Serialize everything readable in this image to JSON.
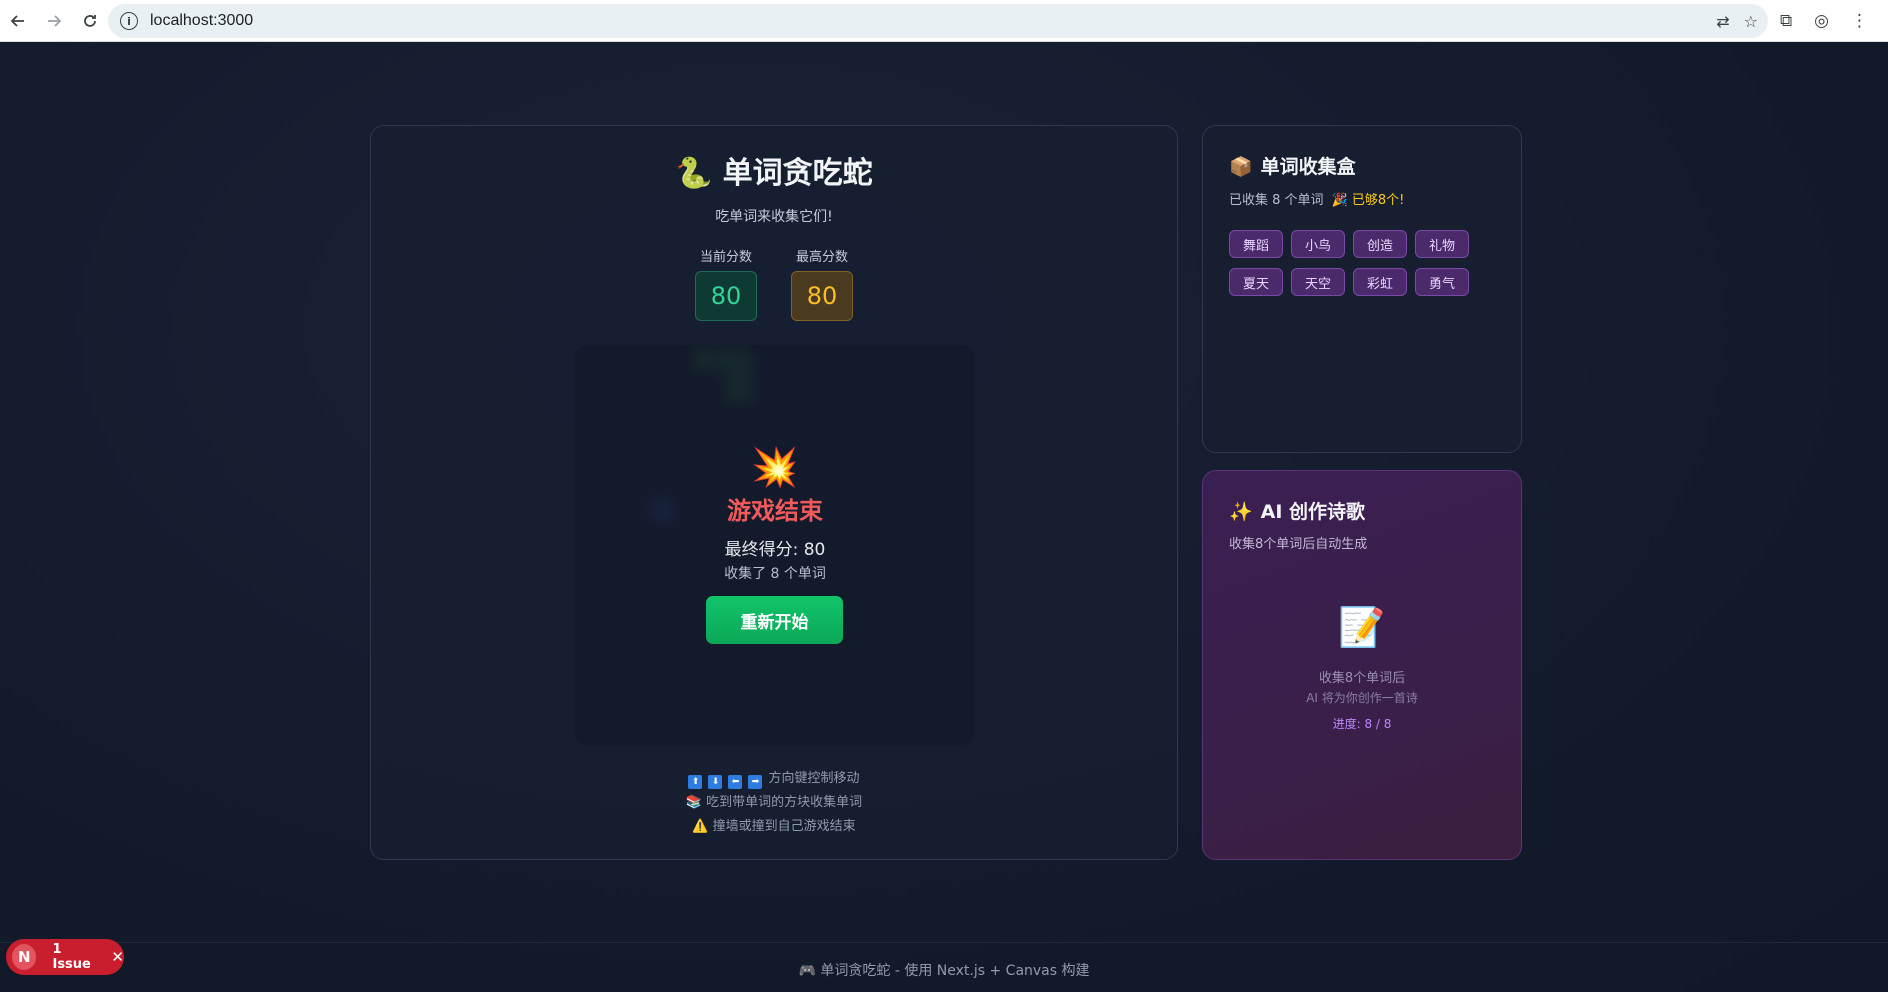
{
  "browser": {
    "url": "localhost:3000",
    "back_icon": "back-arrow-icon",
    "forward_icon": "forward-arrow-icon",
    "reload_icon": "reload-icon"
  },
  "game": {
    "title": "单词贪吃蛇",
    "title_emoji": "🐍",
    "subtitle": "吃单词来收集它们!",
    "current_score_label": "当前分数",
    "current_score": "80",
    "best_score_label": "最高分数",
    "best_score": "80",
    "game_over": {
      "emoji": "💥",
      "title": "游戏结束",
      "final_score": "最终得分: 80",
      "words_collected": "收集了 8 个单词",
      "restart_label": "重新开始"
    },
    "help": {
      "keys": [
        "⬆",
        "⬇",
        "⬅",
        "➡"
      ],
      "move": "方向键控制移动",
      "eat_emoji": "📚",
      "eat": "吃到带单词的方块收集单词",
      "warn_emoji": "⚠️",
      "warn": "撞墙或撞到自己游戏结束"
    }
  },
  "collection": {
    "emoji": "📦",
    "title": "单词收集盒",
    "status": "已收集 8 个单词",
    "status_done": "🎉 已够8个!",
    "words": [
      "舞蹈",
      "小鸟",
      "创造",
      "礼物",
      "夏天",
      "天空",
      "彩虹",
      "勇气"
    ]
  },
  "poem": {
    "emoji": "✨",
    "title": "AI 创作诗歌",
    "subtitle": "收集8个单词后自动生成",
    "icon": "📝",
    "line1": "收集8个单词后",
    "line2": "AI 将为你创作一首诗",
    "progress": "进度: 8 / 8"
  },
  "footer": "🎮 单词贪吃蛇 - 使用 Next.js + Canvas 构建",
  "issue_badge": {
    "letter": "N",
    "label": "1 Issue",
    "close": "✕"
  },
  "colors": {
    "accent_green": "#10c46a",
    "score_green": "#34d399",
    "score_gold": "#fbbf24",
    "game_over_red": "#f05a5a",
    "word_chip_purple": "#4a2a6a"
  }
}
